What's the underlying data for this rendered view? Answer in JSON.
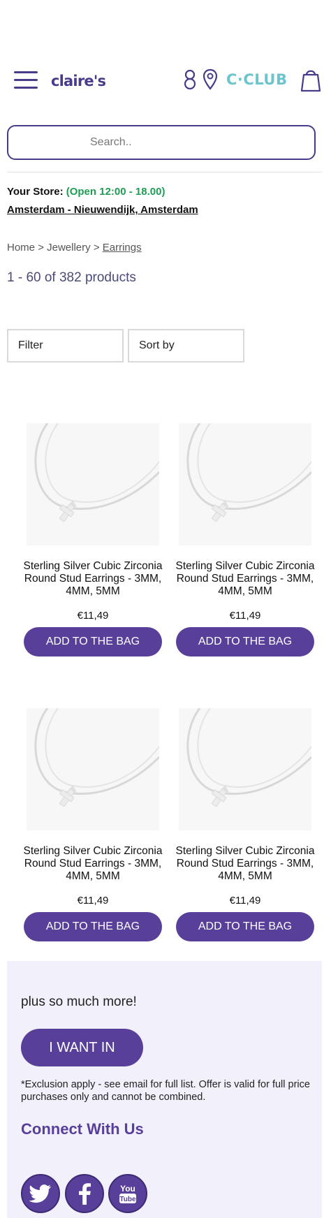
{
  "header": {
    "logo_text": "claire's",
    "club_text": "C·CLUB",
    "icons": [
      "menu-icon",
      "account-icon",
      "store-locator-icon",
      "bag-icon"
    ]
  },
  "search": {
    "placeholder": "Search.."
  },
  "store": {
    "label": "Your Store:",
    "hours": "(Open 12:00 - 18.00)",
    "name": "Amsterdam - Nieuwendijk, Amsterdam"
  },
  "breadcrumb": {
    "home": "Home",
    "separator": ">",
    "jewellery": "Jewellery",
    "current": "Earrings"
  },
  "results": {
    "count_text": "1 - 60 of 382 products"
  },
  "toolbar": {
    "filter_label": "Filter",
    "sort_label": "Sort by"
  },
  "products": [
    {
      "name": "Sterling Silver Cubic Zirconia Round Stud Earrings - 3MM, 4MM, 5MM",
      "price": "€11,49",
      "button": "ADD TO THE BAG"
    },
    {
      "name": "Sterling Silver Cubic Zirconia Round Stud Earrings - 3MM, 4MM, 5MM",
      "price": "€11,49",
      "button": "ADD TO THE BAG"
    },
    {
      "name": "Sterling Silver Cubic Zirconia Round Stud Earrings - 3MM, 4MM, 5MM",
      "price": "€11,49",
      "button": "ADD TO THE BAG"
    },
    {
      "name": "Sterling Silver Cubic Zirconia Round Stud Earrings - 3MM, 4MM, 5MM",
      "price": "€11,49",
      "button": "ADD TO THE BAG"
    }
  ],
  "promo": {
    "text": "plus so much more!",
    "button": "I WANT IN",
    "exclusion": "*Exclusion apply - see email for full list. Offer is valid for full price purchases only and cannot be combined.",
    "connect_title": "Connect With Us",
    "social_icons": [
      "twitter-icon",
      "facebook-icon",
      "youtube-icon"
    ]
  },
  "colors": {
    "brand_purple": "#583f99",
    "club_teal": "#6cc4cc",
    "open_green": "#1f9d55",
    "promo_background": "#f1f0fb"
  }
}
